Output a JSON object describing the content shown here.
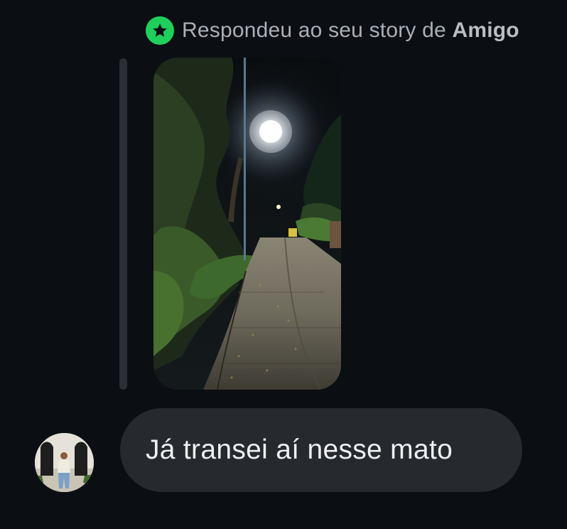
{
  "reply_header": {
    "prefix": "Respondeu ao seu story de ",
    "friend_name": "Amigo",
    "badge_icon": "star-icon",
    "badge_color": "#1fcf5b"
  },
  "story": {
    "icon": "story-photo-night-path-streetlight"
  },
  "message": {
    "text": "Já transei aí nesse mato"
  },
  "avatar": {
    "icon": "avatar-photo"
  },
  "colors": {
    "background": "#0b0e12",
    "bubble": "#26292e",
    "bubble_text": "#eef0f2",
    "header_text": "#aab0b8"
  }
}
